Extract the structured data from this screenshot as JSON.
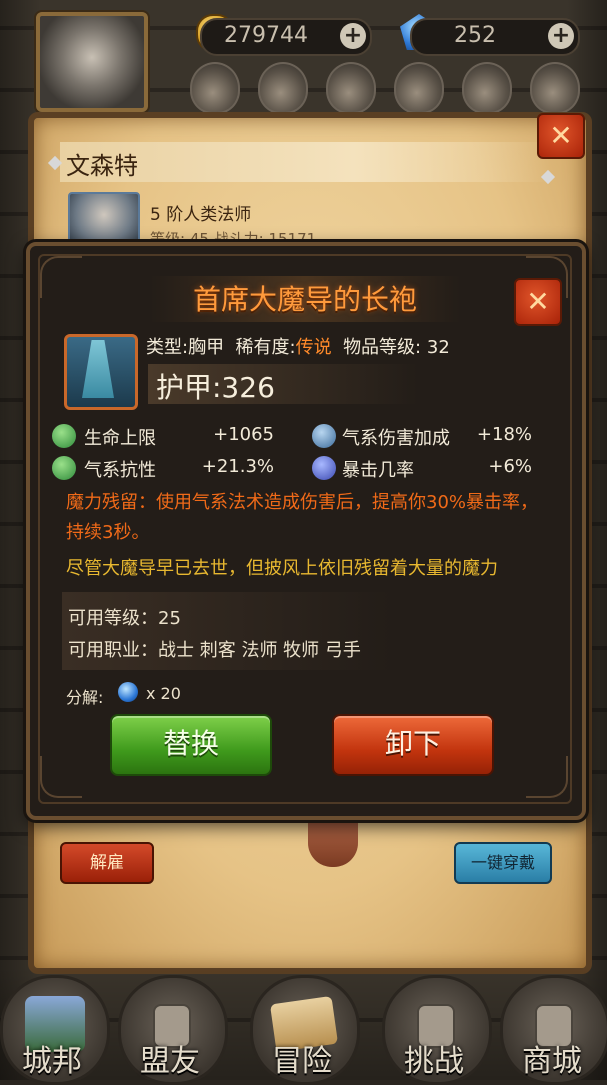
{
  "resources": {
    "gold": "279744",
    "gems": "252",
    "plus_label": "+"
  },
  "hero_panel": {
    "name": "文森特",
    "class": "5 阶人类法师",
    "partial_info": "等级: 45   战斗力: 15171",
    "fire_button": "解雇",
    "equip_all_button": "一键穿戴",
    "close_label": "✕"
  },
  "item_popup": {
    "title": "首席大魔导的长袍",
    "close_label": "✕",
    "type_label": "类型:",
    "type_value": "胸甲",
    "rarity_label": "稀有度:",
    "rarity_value": "传说",
    "item_level_label": "物品等级:",
    "item_level_value": "32",
    "armor": "护甲:326",
    "stats": [
      {
        "name": "生命上限",
        "value": "+1065",
        "color": "#4aa85a"
      },
      {
        "name": "气系伤害加成",
        "value": "+18%",
        "color": "#6a8ab0"
      },
      {
        "name": "气系抗性",
        "value": "+21.3%",
        "color": "#4aa85a"
      },
      {
        "name": "暴击几率",
        "value": "+6%",
        "color": "#4a68c8"
      }
    ],
    "effect": "魔力残留：使用气系法术造成伤害后，提高你30%暴击率，持续3秒。",
    "flavor": "尽管大魔导早已去世，但披风上依旧残留着大量的魔力",
    "required_level": "可用等级：25",
    "required_classes": "可用职业：战士 刺客 法师 牧师 弓手",
    "salvage_label": "分解:",
    "salvage_count": "x 20",
    "replace_button": "替换",
    "unequip_button": "卸下"
  },
  "bottom_nav": [
    {
      "label": "城邦",
      "icon": "city-icon"
    },
    {
      "label": "盟友",
      "icon": "lock-icon"
    },
    {
      "label": "冒险",
      "icon": "sword-map-icon"
    },
    {
      "label": "挑战",
      "icon": "lock-icon"
    },
    {
      "label": "商城",
      "icon": "lock-icon"
    }
  ],
  "colors": {
    "legendary": "#ff8a2a",
    "title_glow": "#ff9a3c",
    "effect_text": "#f06a18",
    "flavor_text": "#e8b830"
  }
}
